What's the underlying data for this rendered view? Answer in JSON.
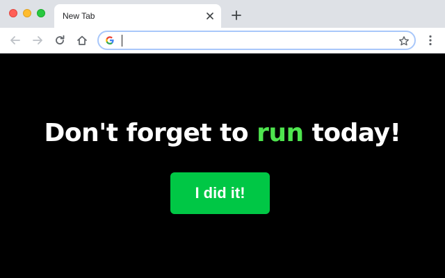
{
  "browser": {
    "tab": {
      "title": "New Tab"
    },
    "omnibox": {
      "value": "",
      "placeholder": ""
    },
    "icons": {
      "tab_close": "close-icon",
      "new_tab": "plus-icon",
      "back": "arrow-left-icon",
      "forward": "arrow-right-icon",
      "reload": "reload-icon",
      "home": "home-icon",
      "search_engine": "google-g-icon",
      "bookmark": "star-icon",
      "menu": "kebab-menu-icon"
    }
  },
  "page": {
    "headline": {
      "before": "Don't forget to ",
      "accent": "run",
      "after": " today!"
    },
    "button_label": "I did it!"
  },
  "colors": {
    "background": "#000000",
    "headline": "#ffffff",
    "accent": "#4ee44e",
    "button": "#00c745",
    "button_text": "#ffffff"
  }
}
